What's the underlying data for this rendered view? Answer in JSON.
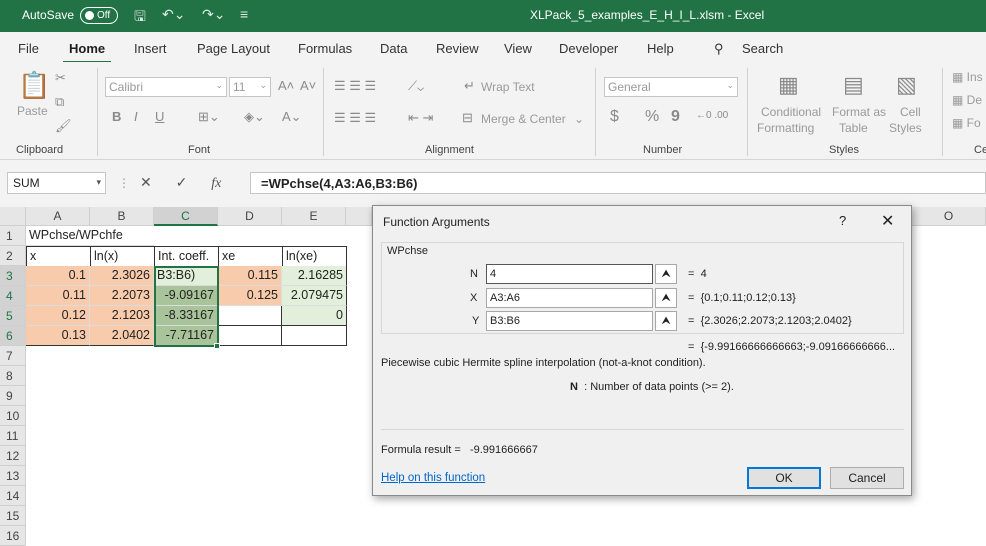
{
  "titlebar": {
    "autosave": "AutoSave",
    "toggle": "Off",
    "document": "XLPack_5_examples_E_H_I_L.xlsm  -  Excel"
  },
  "menu": [
    "File",
    "Home",
    "Insert",
    "Page Layout",
    "Formulas",
    "Data",
    "Review",
    "View",
    "Developer",
    "Help",
    "Search"
  ],
  "ribbon": {
    "clipboard": {
      "label": "Clipboard",
      "paste": "Paste"
    },
    "font": {
      "label": "Font",
      "name": "Calibri",
      "size": "11",
      "bold": "B",
      "italic": "I",
      "underline": "U"
    },
    "alignment": {
      "label": "Alignment",
      "wrap": "Wrap Text",
      "merge": "Merge & Center"
    },
    "number": {
      "label": "Number",
      "format": "General",
      "currency": "$",
      "percent": "%",
      "comma": "9"
    },
    "styles": {
      "label": "Styles",
      "conditional1": "Conditional",
      "conditional2": "Formatting",
      "format_as1": "Format as",
      "format_as2": "Table",
      "cell1": "Cell",
      "cell2": "Styles"
    },
    "cells": {
      "ins": "Ins",
      "del": "De",
      "fo": "Fo",
      "label": "Ce"
    }
  },
  "formula_bar": {
    "name_box": "SUM",
    "fx": "fx",
    "formula": "=WPchse(4,A3:A6,B3:B6)"
  },
  "columns": [
    "A",
    "B",
    "C",
    "D",
    "E",
    "O"
  ],
  "rows": [
    "1",
    "2",
    "3",
    "4",
    "5",
    "6",
    "7",
    "8",
    "9",
    "10",
    "11",
    "12",
    "13",
    "14",
    "15",
    "16"
  ],
  "cells": {
    "A1": "WPchse/WPchfe",
    "A2": "x",
    "B2": "ln(x)",
    "C2": "Int. coeff.",
    "D2": "xe",
    "E2": "ln(xe)",
    "A3": "0.1",
    "B3": "2.3026",
    "C3": "B3:B6)",
    "D3": "0.115",
    "E3": "2.16285",
    "A4": "0.11",
    "B4": "2.2073",
    "C4": "-9.09167",
    "D4": "0.125",
    "E4": "2.079475",
    "A5": "0.12",
    "B5": "2.1203",
    "C5": "-8.33167",
    "E5": "0",
    "A6": "0.13",
    "B6": "2.0402",
    "C6": "-7.71167"
  },
  "dialog": {
    "title": "Function Arguments",
    "help": "?",
    "close": "✕",
    "function": "WPchse",
    "args": [
      {
        "name": "N",
        "value": "4",
        "result": "4"
      },
      {
        "name": "X",
        "value": "A3:A6",
        "result": "{0.1;0.11;0.12;0.13}"
      },
      {
        "name": "Y",
        "value": "B3:B6",
        "result": "{2.3026;2.2073;2.1203;2.0402}"
      }
    ],
    "overall_result": "{-9.99166666666663;-9.09166666666...",
    "description": "Piecewise cubic Hermite spline interpolation (not-a-knot condition).",
    "arg_help_name": "N",
    "arg_help": ": Number of data points (>= 2).",
    "formula_result_label": "Formula result =",
    "formula_result": "-9.991666667",
    "help_link": "Help on this function",
    "ok": "OK",
    "cancel": "Cancel",
    "eq": "="
  }
}
